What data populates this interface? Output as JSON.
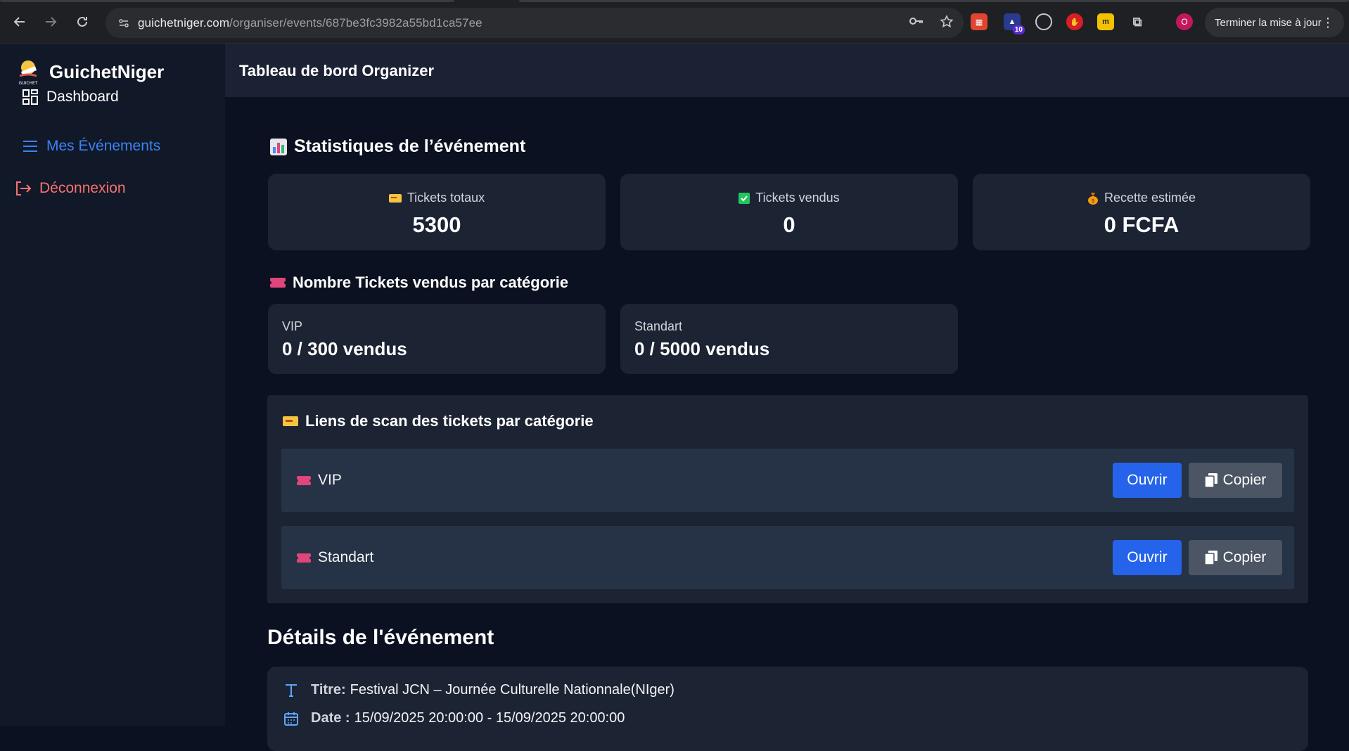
{
  "browser": {
    "url_host": "guichetniger.com",
    "url_path": "/organiser/events/687be3fc3982a55bd1ca57ee",
    "profile_initial": "O",
    "extension_badge": "10",
    "update_label": "Terminer la mise à jour"
  },
  "sidebar": {
    "brand_name": "GuichetNiger",
    "brand_logo_text": "GUICHET",
    "items": [
      {
        "label": "Dashboard",
        "icon": "dashboard-grid-icon",
        "color": "#ffffff"
      },
      {
        "label": "Mes Événements",
        "icon": "menu-lines-icon",
        "color": "#3b82f6"
      },
      {
        "label": "Déconnexion",
        "icon": "logout-icon",
        "color": "#f87171"
      }
    ]
  },
  "header": {
    "title": "Tableau de bord Organizer"
  },
  "stats": {
    "title": "Statistiques de l’événement",
    "cards": [
      {
        "label": "Tickets totaux",
        "value": "5300",
        "icon": "ticket-emoji-icon"
      },
      {
        "label": "Tickets vendus",
        "value": "0",
        "icon": "check-box-icon"
      },
      {
        "label": "Recette estimée",
        "value": "0 FCFA",
        "icon": "money-bag-icon"
      }
    ]
  },
  "categories": {
    "title": "Nombre Tickets vendus par catégorie",
    "items": [
      {
        "name": "VIP",
        "value": "0 / 300 vendus"
      },
      {
        "name": "Standart",
        "value": "0 / 5000 vendus"
      }
    ]
  },
  "scan_links": {
    "title": "Liens de scan des tickets par catégorie",
    "open_label": "Ouvrir",
    "copy_label": "Copier",
    "rows": [
      {
        "name": "VIP"
      },
      {
        "name": "Standart"
      }
    ]
  },
  "details": {
    "title": "Détails de l'événement",
    "title_label": "Titre:",
    "title_value": "Festival JCN – Journée Culturelle Nationnale(NIger)",
    "date_label": "Date :",
    "date_value": "15/09/2025 20:00:00 - 15/09/2025 20:00:00"
  },
  "colors": {
    "accent": "#2563eb",
    "active_nav": "#3b82f6",
    "logout": "#f87171"
  }
}
